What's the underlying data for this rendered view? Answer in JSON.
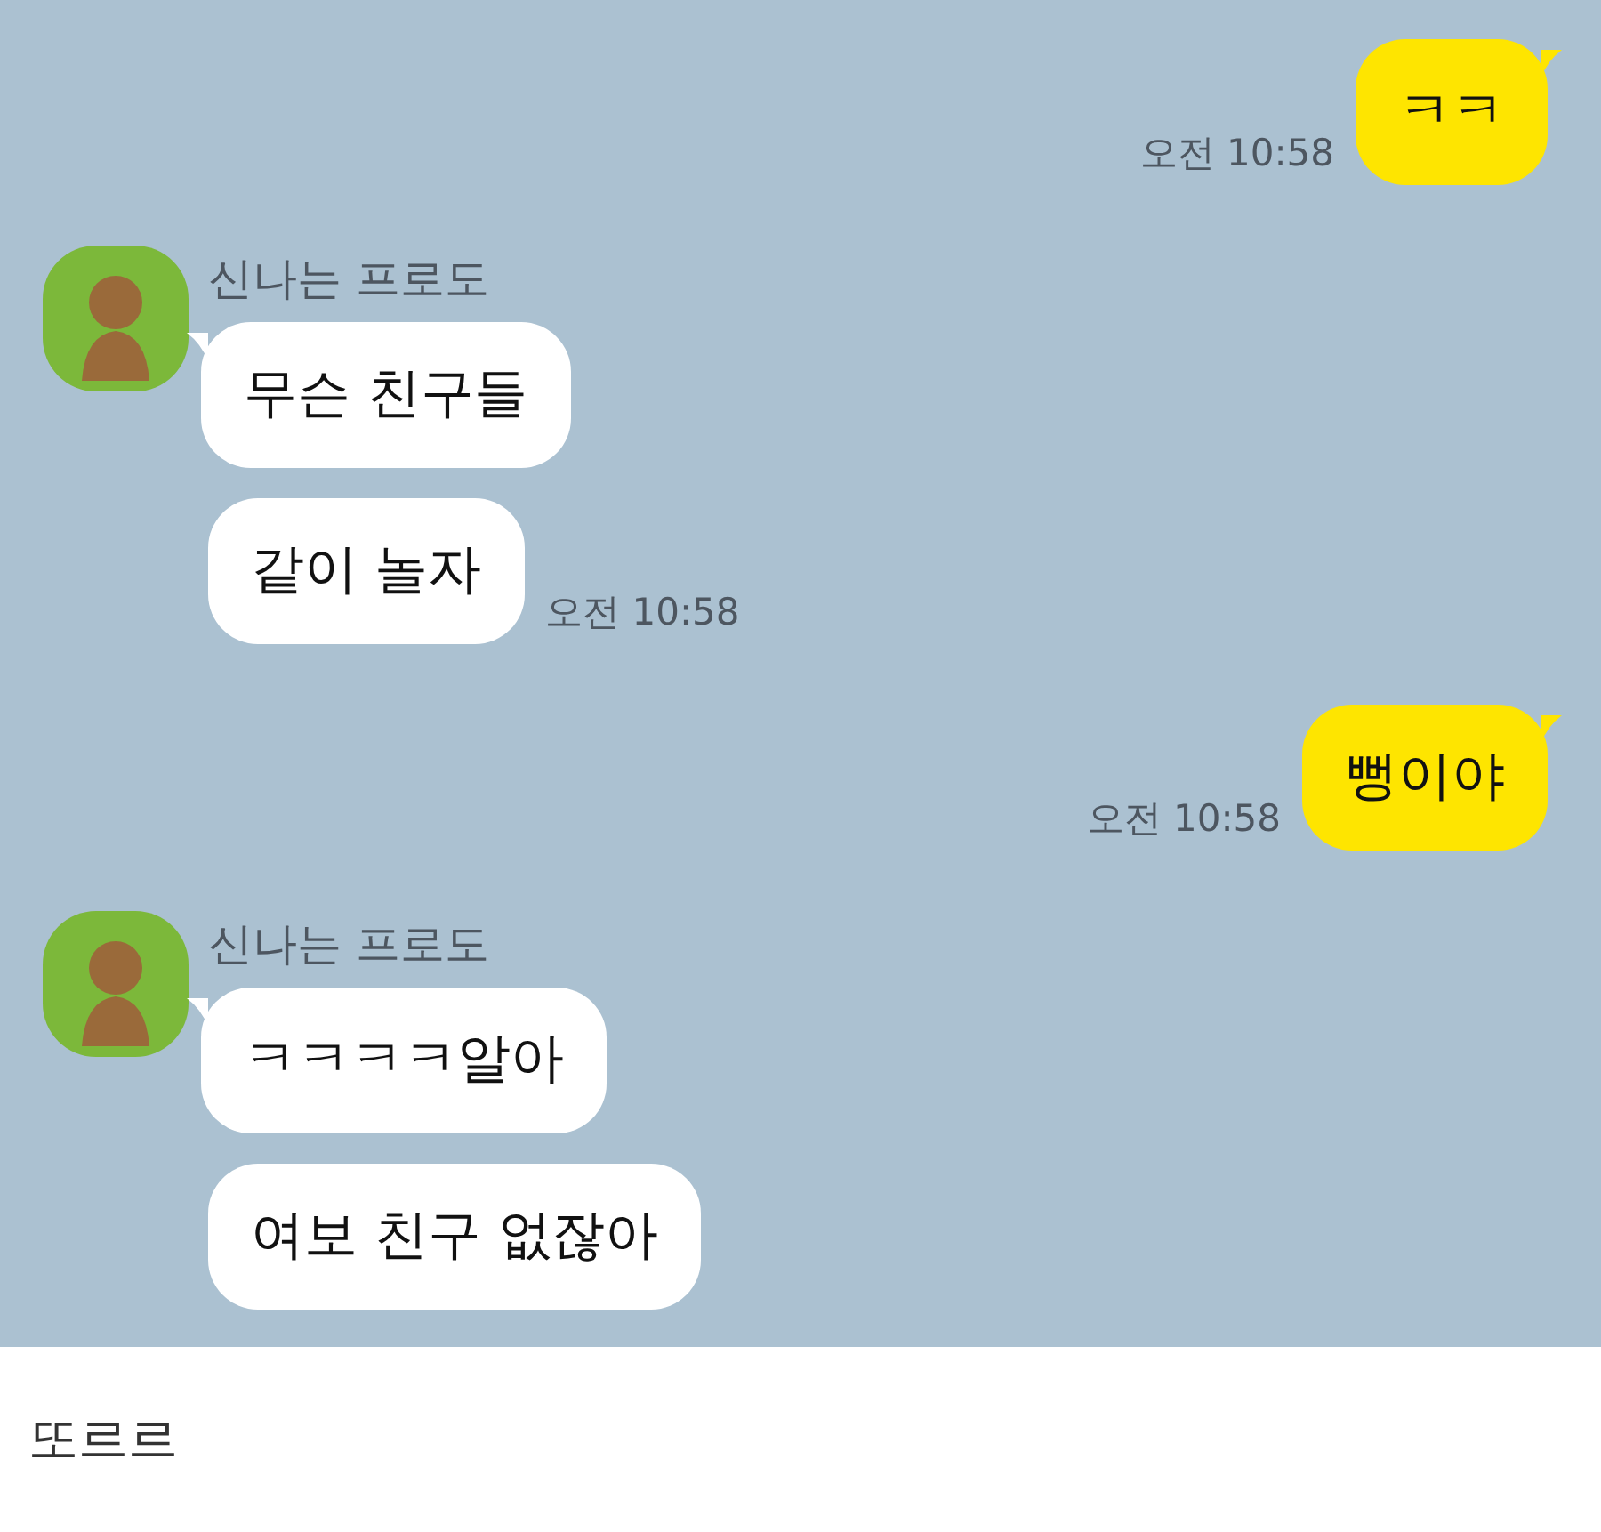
{
  "messages": [
    {
      "kind": "sent",
      "bubbles": [
        "ㅋㅋ"
      ],
      "time": "오전 10:58"
    },
    {
      "kind": "received",
      "sender": "신나는 프로도",
      "bubbles": [
        "무슨 친구들",
        "같이 놀자"
      ],
      "time": "오전 10:58"
    },
    {
      "kind": "sent",
      "bubbles": [
        "뻥이야"
      ],
      "time": "오전 10:58"
    },
    {
      "kind": "received",
      "sender": "신나는 프로도",
      "bubbles": [
        "ㅋㅋㅋㅋ알아",
        "여보 친구 없잖아"
      ]
    }
  ],
  "caption": "또르르"
}
